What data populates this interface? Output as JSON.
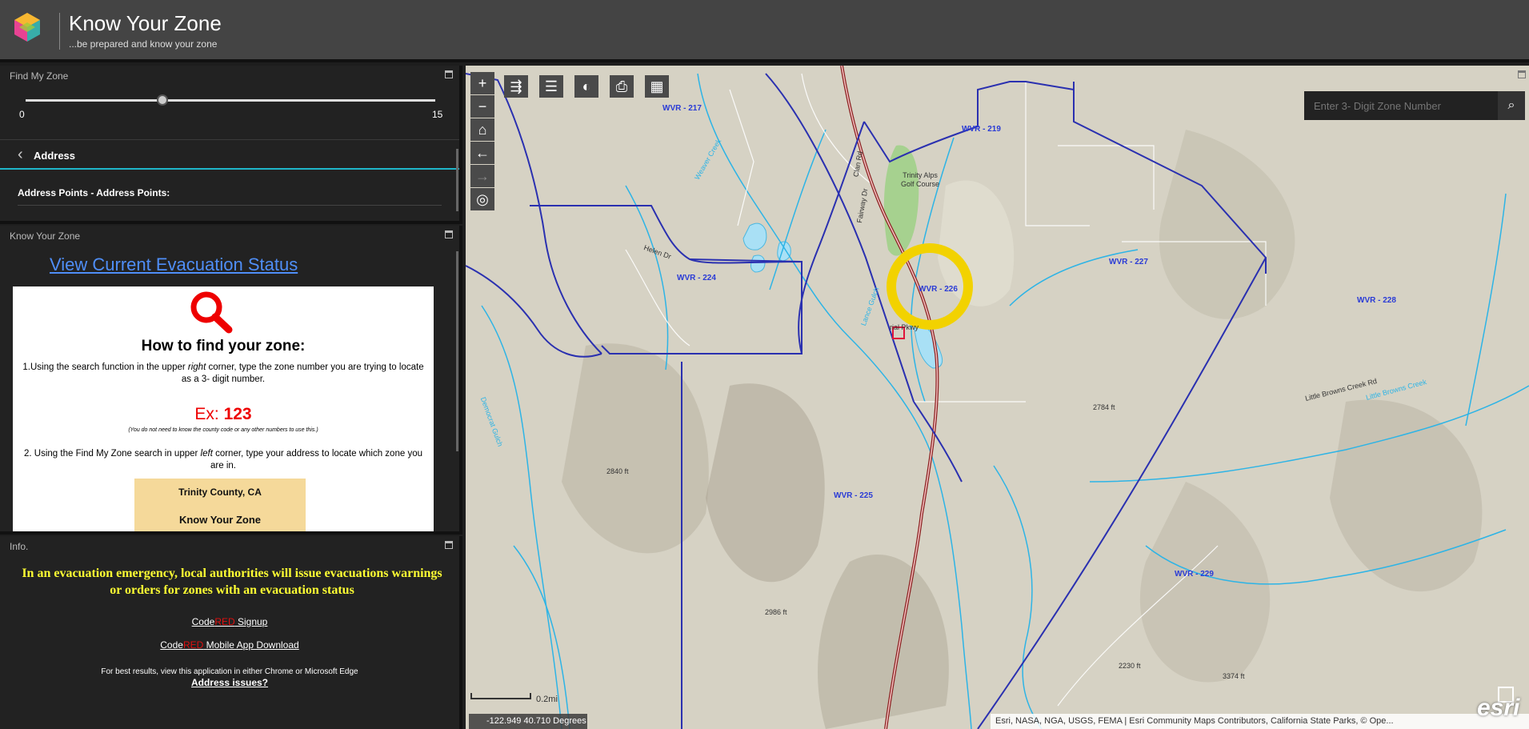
{
  "header": {
    "title": "Know Your Zone",
    "subtitle": "...be prepared and know your zone"
  },
  "find_zone": {
    "title": "Find My Zone",
    "slider": {
      "min": "0",
      "max": "15",
      "value": 5
    },
    "address_label": "Address",
    "address_points_label": "Address Points - Address Points:"
  },
  "know_zone": {
    "title": "Know Your Zone",
    "evac_link": "View Current Evacuation Status",
    "heading": "How to find your zone:",
    "step1_a": "1.Using the search function in the upper ",
    "step1_em": "right",
    "step1_b": " corner, type the zone number you are trying to locate as a 3- digit number.",
    "ex_prefix": "Ex: ",
    "ex_value": "123",
    "note": "(You do not need to know the county code or any other numbers to use this.)",
    "step2_a": "2. Using the Find My Zone search in upper ",
    "step2_em": "left",
    "step2_b": " corner, type your address to locate which zone you are in.",
    "thumb_title": "Trinity County, CA",
    "thumb_sub": "Know Your Zone"
  },
  "info": {
    "title": "Info.",
    "warning": "In an evacuation emergency, local authorities will issue evacuations warnings or orders for zones with an evacuation status",
    "code": "Code",
    "red": "RED",
    "signup": " Signup",
    "mobile": " Mobile App Download",
    "best": "For best results, view this application in either Chrome or Microsoft Edge",
    "issues": "Address issues?"
  },
  "map": {
    "search_placeholder": "Enter 3- Digit Zone Number",
    "coords": "-122.949 40.710 Degrees",
    "scale": "0.2mi",
    "attribution": "Esri, NASA, NGA, USGS, FEMA | Esri Community Maps Contributors, California State Parks, © Ope...",
    "brand": "esri",
    "zones": [
      "WVR - 217",
      "WVR - 219",
      "WVR - 224",
      "WVR - 226",
      "WVR - 227",
      "WVR - 228",
      "WVR - 225",
      "WVR - 229"
    ],
    "streets": [
      "Helen Dr",
      "Clan Rd",
      "Fairway Dr",
      "Trinity Alps Golf Course",
      "Weaver Creek",
      "Lance Gulch",
      "Democrat Gulch",
      "Little Browns Creek",
      "Little Browns Creek Rd",
      "rial Pkwy"
    ],
    "elevations": [
      "2784 ft",
      "2840 ft",
      "2986 ft",
      "2230 ft",
      "3374 ft"
    ]
  },
  "colors": {
    "accent": "#1fb6c9",
    "zone_line": "#2a30b0",
    "highlight": "#f2d200",
    "warning": "#ffff33"
  },
  "icons": [
    "zoom-in-icon",
    "zoom-out-icon",
    "home-icon",
    "back-icon",
    "forward-icon",
    "locate-icon",
    "share-icon",
    "layers-icon",
    "basemap-icon",
    "print-icon",
    "grid-icon",
    "search-icon"
  ]
}
